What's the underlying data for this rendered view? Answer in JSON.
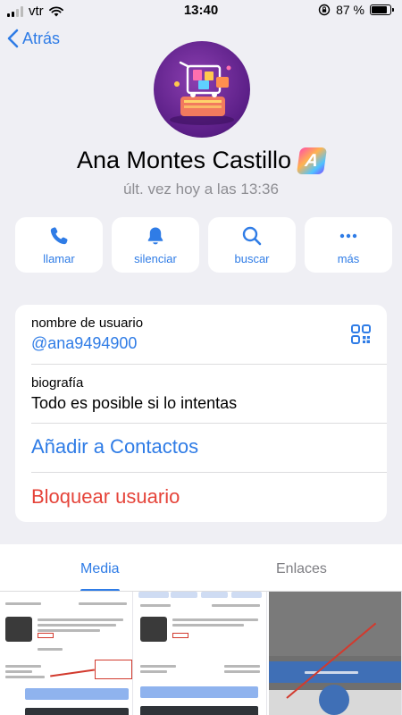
{
  "status_bar": {
    "carrier": "vtr",
    "time": "13:40",
    "battery_percent": "87 %",
    "battery_level": 0.87
  },
  "nav": {
    "back_label": "Atrás"
  },
  "profile": {
    "name": "Ana Montes Castillo",
    "badge_letter": "A",
    "last_seen": "últ. vez hoy a las 13:36"
  },
  "actions": [
    {
      "label": "llamar",
      "icon": "phone-icon"
    },
    {
      "label": "silenciar",
      "icon": "bell-icon"
    },
    {
      "label": "buscar",
      "icon": "search-icon"
    },
    {
      "label": "más",
      "icon": "more-icon"
    }
  ],
  "info": {
    "username_label": "nombre de usuario",
    "username_value": "@ana9494900",
    "bio_label": "biografía",
    "bio_value": "Todo es posible si lo intentas",
    "add_contact": "Añadir a Contactos",
    "block_user": "Bloquear usuario"
  },
  "tabs": [
    {
      "label": "Media",
      "active": true
    },
    {
      "label": "Enlaces",
      "active": false
    }
  ],
  "colors": {
    "accent": "#2f7ce6",
    "danger": "#e5443a",
    "background": "#efeff4",
    "secondary_text": "#8e8e93"
  }
}
